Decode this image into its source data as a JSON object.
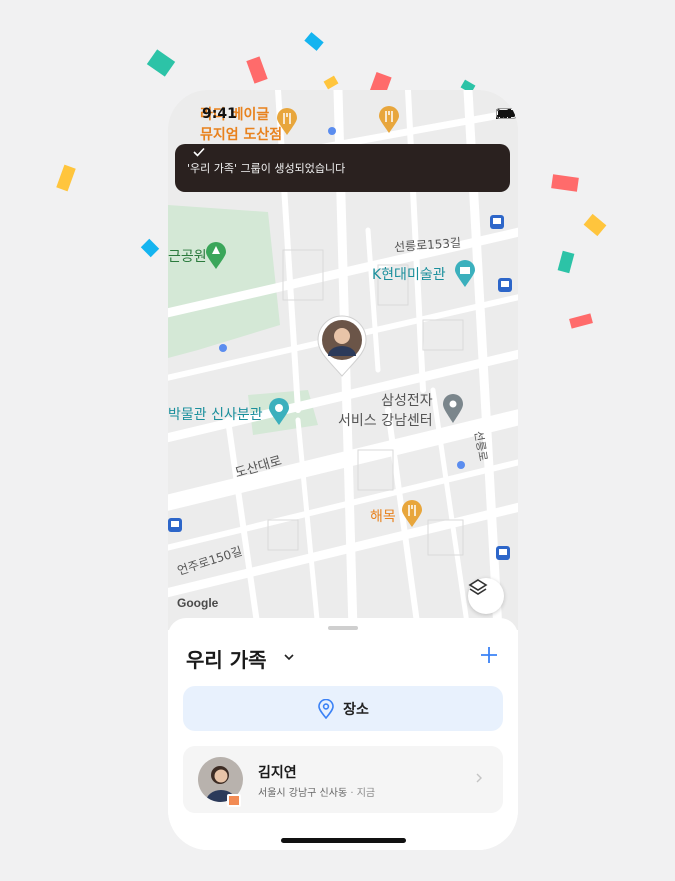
{
  "status_bar": {
    "time": "9:41"
  },
  "toast": {
    "message": "'우리 가족' 그룹이 생성되었습니다"
  },
  "map": {
    "labels": {
      "top_left_poi_line1": "라디 베이글",
      "top_left_poi_line2": "뮤지엄 도산점",
      "park": "근공원",
      "road_seolleung": "선릉로153길",
      "museum": "K현대미술관",
      "samsung_line1": "삼성전자",
      "samsung_line2": "서비스 강남센터",
      "branch": "박물관 신사분관",
      "dosan": "도산대로",
      "seolleung_ro": "선릉로",
      "haemok": "해목",
      "eonju": "언주로150길"
    },
    "attribution": "Google",
    "colors": {
      "poi_orange": "#e8821e",
      "poi_teal": "#1a8f9c",
      "park": "#d4e8d6",
      "road": "#ffffff"
    }
  },
  "sheet": {
    "group_name": "우리 가족",
    "places_label": "장소",
    "member": {
      "name": "김지연",
      "location": "서울시 강남구 신사동",
      "time": "· 지금"
    }
  },
  "colors": {
    "accent": "#3b82f6",
    "toast_bg": "#2a211f",
    "place_bg": "#e8f1fd"
  },
  "icons": [
    "check-icon",
    "location-pin-icon",
    "chevron-down-icon",
    "plus-icon",
    "layers-icon",
    "chevron-right-icon",
    "restaurant-pin-icon",
    "tree-pin-icon",
    "museum-pin-icon",
    "bus-stop-icon"
  ]
}
